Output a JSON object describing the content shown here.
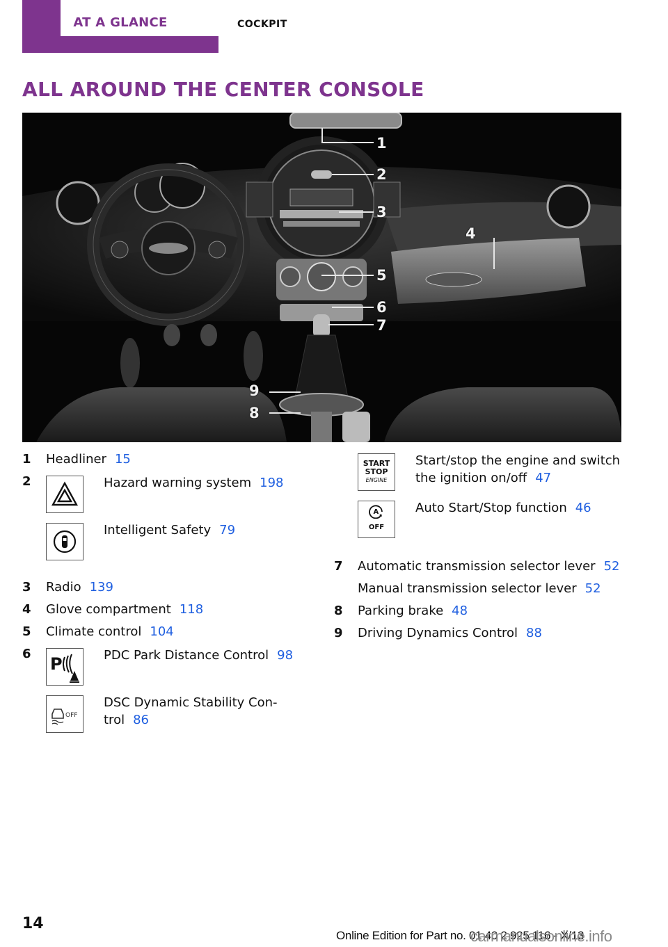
{
  "header": {
    "chapter_tab": "AT A GLANCE",
    "section": "COCKPIT"
  },
  "page_title": "ALL AROUND THE CENTER CONSOLE",
  "photo": {
    "description": "Grayscale photo of MINI dashboard and center console",
    "callouts": [
      "1",
      "2",
      "3",
      "4",
      "5",
      "6",
      "7",
      "8",
      "9"
    ]
  },
  "left_column": {
    "items": [
      {
        "number": "1",
        "label": "Headliner",
        "page": "15"
      },
      {
        "number": "2",
        "icon": "hazard-warning-icon",
        "label": "Hazard warning system",
        "page": "198"
      },
      {
        "number": "",
        "icon": "intelligent-safety-icon",
        "label": "Intelligent Safety",
        "page": "79"
      },
      {
        "number": "3",
        "label": "Radio",
        "page": "139"
      },
      {
        "number": "4",
        "label": "Glove compartment",
        "page": "118"
      },
      {
        "number": "5",
        "label": "Climate control",
        "page": "104"
      },
      {
        "number": "6",
        "icon": "pdc-icon",
        "label": "PDC Park Distance Control",
        "page": "98"
      },
      {
        "number": "",
        "icon": "dsc-off-icon",
        "label": "DSC Dynamic Stability Con-\ntrol",
        "label_line1": "DSC Dynamic Stability Con-",
        "label_line2": "trol",
        "page": "86"
      }
    ]
  },
  "right_column": {
    "items": [
      {
        "number": "",
        "icon": "start-stop-engine-icon",
        "label_line1": "Start/stop the engine and switch",
        "label_line2": "the ignition on/off",
        "page": "47"
      },
      {
        "number": "",
        "icon": "auto-start-stop-off-icon",
        "label": "Auto Start/Stop function",
        "page": "46"
      },
      {
        "number": "7",
        "label": "Automatic transmission selector lever",
        "page": "52"
      },
      {
        "number": "",
        "label": "Manual transmission selector lever",
        "page": "52"
      },
      {
        "number": "8",
        "label": "Parking brake",
        "page": "48"
      },
      {
        "number": "9",
        "label": "Driving Dynamics Control",
        "page": "88"
      }
    ]
  },
  "icon_text": {
    "start": "START",
    "stop": "STOP",
    "engine": "ENGINE",
    "a": "A",
    "off": "OFF",
    "p": "P"
  },
  "footer": {
    "page_number": "14",
    "edition": "Online Edition for Part no. 01 40 2 925 116 - X/13",
    "watermark": "carmanualsonline.info"
  },
  "colors": {
    "brand_purple": "#7e348e",
    "page_ref_blue": "#1f5fe0"
  }
}
